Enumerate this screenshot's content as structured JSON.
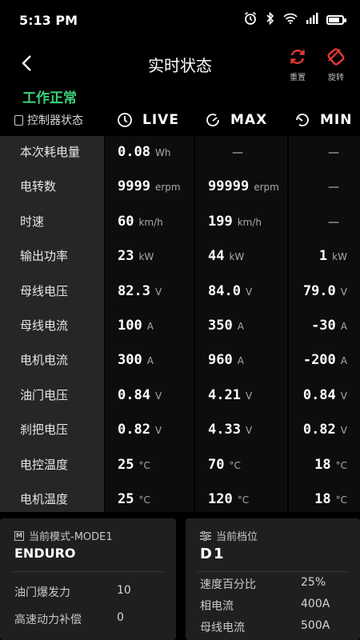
{
  "status_bar": {
    "time": "5:13 PM",
    "icons": [
      "alarm-icon",
      "bluetooth-icon",
      "wifi-icon",
      "signal-icon",
      "battery-icon"
    ],
    "battery_level": 0.8
  },
  "header": {
    "title": "实时状态",
    "reset_label": "重置",
    "rotate_label": "旋转",
    "accent_color": "#e53935"
  },
  "work_status": {
    "text": "工作正常",
    "color": "#3cd37a"
  },
  "table": {
    "label_header": "控制器状态",
    "columns": [
      {
        "key": "live",
        "title": "LIVE",
        "icon": "clock-icon"
      },
      {
        "key": "max",
        "title": "MAX",
        "icon": "gauge-max-icon"
      },
      {
        "key": "min",
        "title": "MIN",
        "icon": "gauge-min-icon"
      }
    ],
    "rows": [
      {
        "label": "本次耗电量",
        "live": {
          "value": "0.08",
          "unit": "Wh"
        },
        "max": {
          "value": "—",
          "unit": ""
        },
        "min": {
          "value": "—",
          "unit": ""
        }
      },
      {
        "label": "电转数",
        "live": {
          "value": "9999",
          "unit": "erpm"
        },
        "max": {
          "value": "99999",
          "unit": "erpm"
        },
        "min": {
          "value": "—",
          "unit": ""
        }
      },
      {
        "label": "时速",
        "live": {
          "value": "60",
          "unit": "km/h"
        },
        "max": {
          "value": "199",
          "unit": "km/h"
        },
        "min": {
          "value": "—",
          "unit": ""
        }
      },
      {
        "label": "输出功率",
        "live": {
          "value": "23",
          "unit": "kW"
        },
        "max": {
          "value": "44",
          "unit": "kW"
        },
        "min": {
          "value": "1",
          "unit": "kW"
        }
      },
      {
        "label": "母线电压",
        "live": {
          "value": "82.3",
          "unit": "V"
        },
        "max": {
          "value": "84.0",
          "unit": "V"
        },
        "min": {
          "value": "79.0",
          "unit": "V"
        }
      },
      {
        "label": "母线电流",
        "live": {
          "value": "100",
          "unit": "A"
        },
        "max": {
          "value": "350",
          "unit": "A"
        },
        "min": {
          "value": "-30",
          "unit": "A"
        }
      },
      {
        "label": "电机电流",
        "live": {
          "value": "300",
          "unit": "A"
        },
        "max": {
          "value": "960",
          "unit": "A"
        },
        "min": {
          "value": "-200",
          "unit": "A"
        }
      },
      {
        "label": "油门电压",
        "live": {
          "value": "0.84",
          "unit": "V"
        },
        "max": {
          "value": "4.21",
          "unit": "V"
        },
        "min": {
          "value": "0.84",
          "unit": "V"
        }
      },
      {
        "label": "刹把电压",
        "live": {
          "value": "0.82",
          "unit": "V"
        },
        "max": {
          "value": "4.33",
          "unit": "V"
        },
        "min": {
          "value": "0.82",
          "unit": "V"
        }
      },
      {
        "label": "电控温度",
        "live": {
          "value": "25",
          "unit": "°C"
        },
        "max": {
          "value": "70",
          "unit": "°C"
        },
        "min": {
          "value": "18",
          "unit": "°C"
        }
      },
      {
        "label": "电机温度",
        "live": {
          "value": "25",
          "unit": "°C"
        },
        "max": {
          "value": "120",
          "unit": "°C"
        },
        "min": {
          "value": "18",
          "unit": "°C"
        }
      }
    ]
  },
  "mode_card": {
    "title": "当前模式-MODE1",
    "icon_letter": "M",
    "mode_name": "ENDURO",
    "items": [
      {
        "key": "油门爆发力",
        "value": "10"
      },
      {
        "key": "高速动力补偿",
        "value": "0"
      }
    ]
  },
  "gear_card": {
    "title": "当前档位",
    "icon": "sliders-icon",
    "gear_name": "D1",
    "items": [
      {
        "key": "速度百分比",
        "value": "25%"
      },
      {
        "key": "相电流",
        "value": "400A"
      },
      {
        "key": "母线电流",
        "value": "500A"
      }
    ]
  }
}
